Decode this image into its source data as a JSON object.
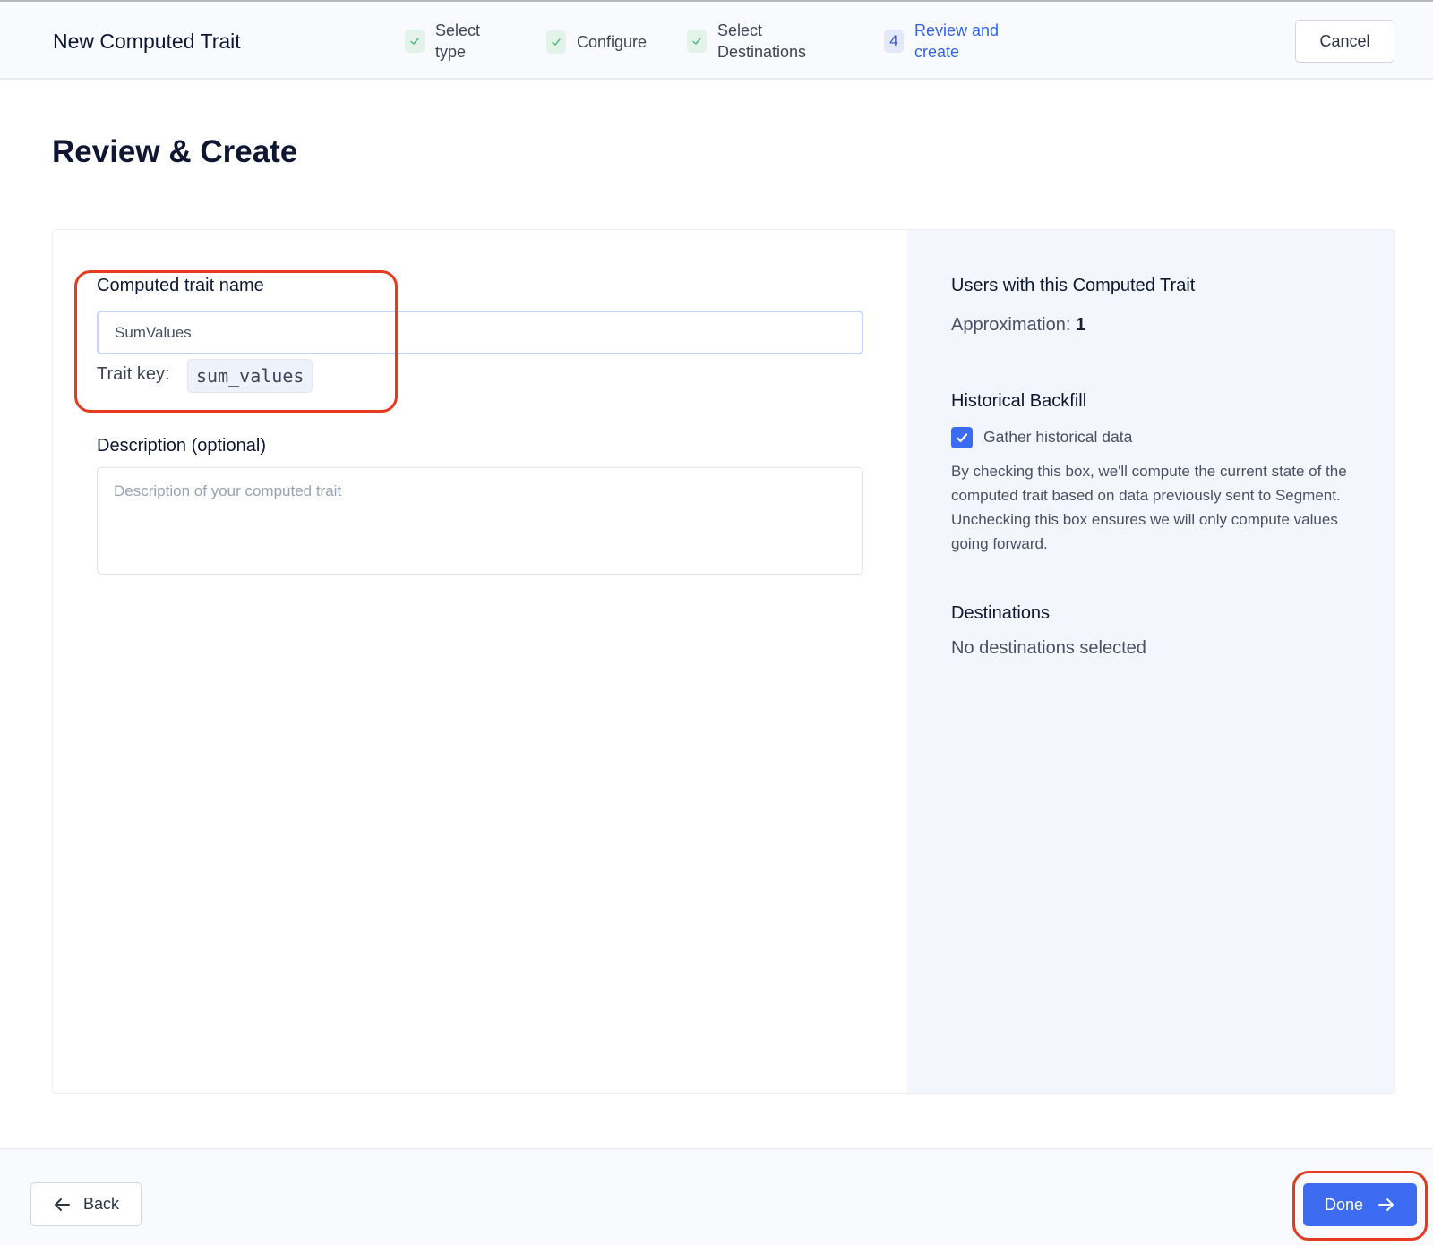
{
  "header": {
    "title": "New Computed Trait",
    "steps": [
      {
        "label_line1": "Select",
        "label_line2": "type",
        "status": "complete",
        "icon": "check-icon"
      },
      {
        "label": "Configure",
        "status": "complete",
        "icon": "check-icon"
      },
      {
        "label_line1": "Select",
        "label_line2": "Destinations",
        "status": "complete",
        "icon": "check-icon"
      },
      {
        "number": "4",
        "label_line1": "Review and",
        "label_line2": "create",
        "status": "active"
      }
    ],
    "cancel_label": "Cancel"
  },
  "page": {
    "title": "Review & Create"
  },
  "form": {
    "name_label": "Computed trait name",
    "name_value": "SumValues",
    "trait_key_label": "Trait key:",
    "trait_key_value": "sum_values",
    "description_label": "Description (optional)",
    "description_placeholder": "Description of your computed trait",
    "description_value": ""
  },
  "summary": {
    "users_heading": "Users with this Computed Trait",
    "approximation_label": "Approximation:",
    "approximation_value": "1",
    "backfill_heading": "Historical Backfill",
    "backfill_checkbox_label": "Gather historical data",
    "backfill_checked": true,
    "backfill_help": "By checking this box, we'll compute the current state of the computed trait based on data previously sent to Segment. Unchecking this box ensures we will only compute values going forward.",
    "destinations_heading": "Destinations",
    "destinations_value": "No destinations selected"
  },
  "footer": {
    "back_label": "Back",
    "done_label": "Done"
  },
  "colors": {
    "primary": "#3d6cf2",
    "complete_step": "#e3f3ea",
    "highlight_annotation": "#e53a1f"
  }
}
